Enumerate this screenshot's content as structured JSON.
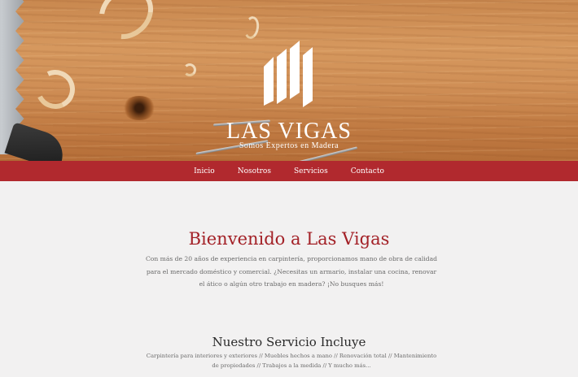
{
  "hero": {
    "brand_name": "LAS VIGAS",
    "tagline": "Somos Expertos en Madera"
  },
  "nav": {
    "items": [
      {
        "label": "Inicio"
      },
      {
        "label": "Nosotros"
      },
      {
        "label": "Servicios"
      },
      {
        "label": "Contacto"
      }
    ]
  },
  "welcome": {
    "title": "Bienvenido a Las Vigas",
    "text": "Con más de 20 años de experiencia en carpintería, proporcionamos mano de obra de calidad para el mercado doméstico y comercial. ¿Necesitas un armario, instalar una cocina, renovar el ático o algún otro trabajo en madera? ¡No busques más!"
  },
  "services": {
    "title": "Nuestro Servicio Incluye",
    "text": "Carpintería para interiores y exteriores // Muebles hechos a mano // Renovación total // Mantenimiento de propiedades // Trabajos a la medida // Y mucho más..."
  },
  "colors": {
    "nav_bg": "#b1292e",
    "title_red": "#a32127",
    "page_bg": "#f2f1f1"
  },
  "icons": {
    "logo": "las-vigas-beams-logo"
  }
}
